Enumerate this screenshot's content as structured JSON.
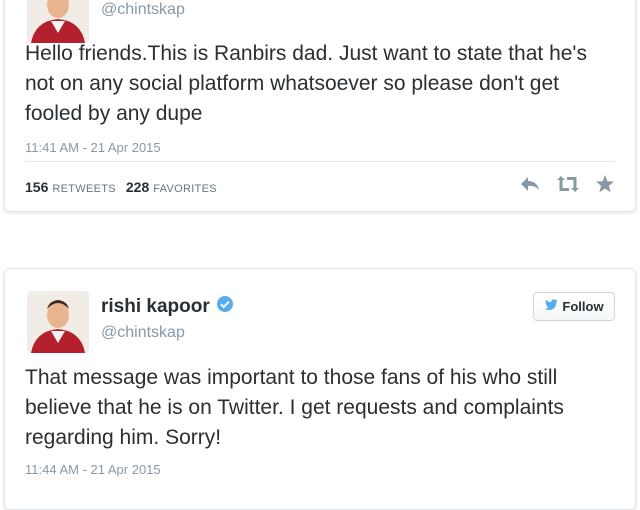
{
  "tweets": [
    {
      "handle": "@chintskap",
      "text": "Hello friends.This is Ranbirs dad. Just want to state that he's not on any social platform whatsoever so please don't get fooled by any dupe",
      "timestamp": "11:41 AM - 21 Apr 2015",
      "retweets_count": "156",
      "retweets_label": "RETWEETS",
      "favorites_count": "228",
      "favorites_label": "FAVORITES"
    },
    {
      "display_name": "rishi kapoor",
      "handle": "@chintskap",
      "follow_label": "Follow",
      "text": "That message was important to those fans of his who still believe that he is on Twitter. I get requests and complaints regarding him. Sorry!",
      "timestamp": "11:44 AM - 21 Apr 2015"
    }
  ],
  "colors": {
    "text": "#292f33",
    "muted": "#8899a6",
    "verified": "#55acee",
    "action_icons": "#8899a6"
  },
  "icons": {
    "reply": "reply-icon",
    "retweet": "retweet-icon",
    "favorite": "star-icon",
    "verified": "verified-badge-icon",
    "follow": "twitter-bird-icon"
  }
}
